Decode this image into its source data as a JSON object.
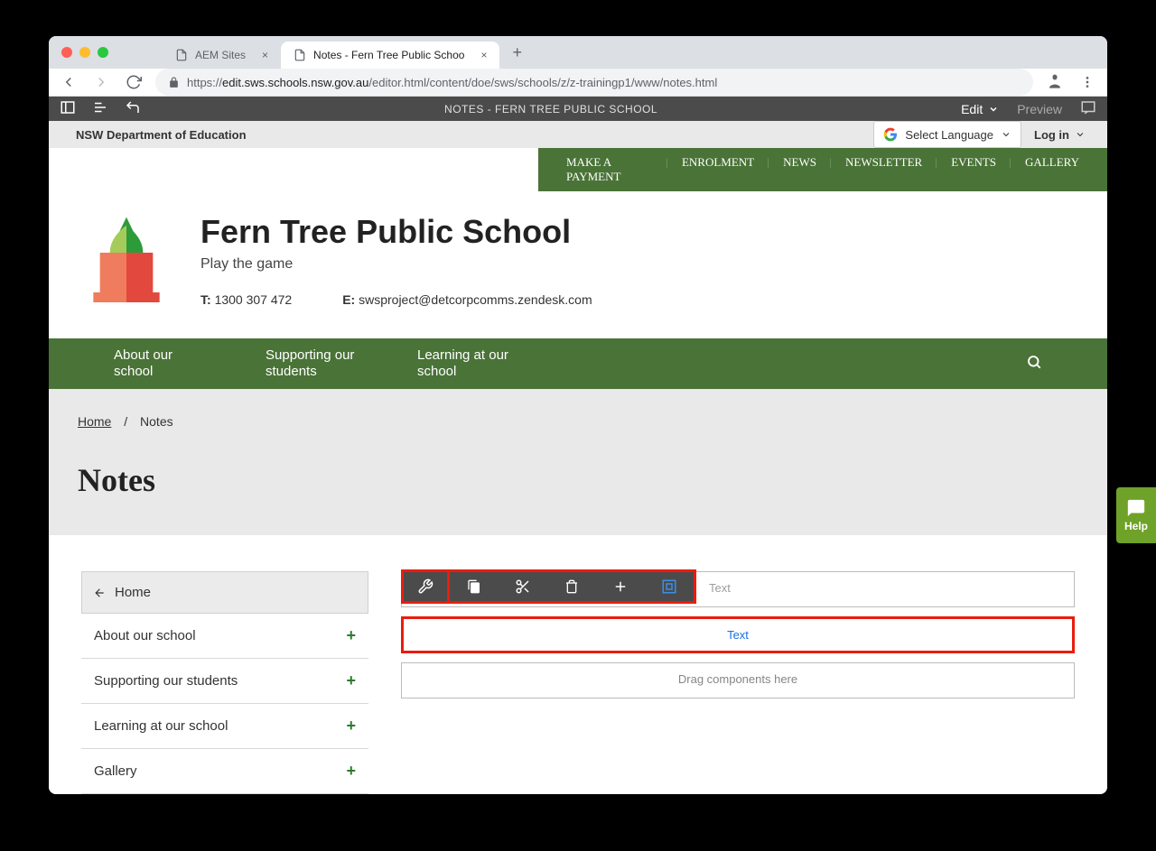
{
  "browser": {
    "tabs": [
      {
        "label": "AEM Sites",
        "active": false
      },
      {
        "label": "Notes - Fern Tree Public Schoo",
        "active": true
      }
    ],
    "url_proto": "https://",
    "url_host": "edit.sws.schools.nsw.gov.au",
    "url_path": "/editor.html/content/doe/sws/schools/z/z-trainingp1/www/notes.html"
  },
  "aem": {
    "title": "NOTES - FERN TREE PUBLIC SCHOOL",
    "edit": "Edit",
    "preview": "Preview"
  },
  "dept": {
    "name": "NSW Department of Education",
    "lang": "Select Language",
    "login": "Log in"
  },
  "util_nav": [
    "MAKE A PAYMENT",
    "ENROLMENT",
    "NEWS",
    "NEWSLETTER",
    "EVENTS",
    "GALLERY"
  ],
  "school": {
    "name": "Fern Tree Public School",
    "tagline": "Play the game",
    "phone_label": "T:",
    "phone": "1300 307 472",
    "email_label": "E:",
    "email": "swsproject@detcorpcomms.zendesk.com"
  },
  "main_nav": [
    "About our school",
    "Supporting our students",
    "Learning at our school"
  ],
  "breadcrumb": {
    "home": "Home",
    "current": "Notes"
  },
  "page_title": "Notes",
  "side_menu": {
    "home": "Home",
    "items": [
      "About our school",
      "Supporting our students",
      "Learning at our school",
      "Gallery"
    ]
  },
  "components": {
    "text1": "Text",
    "text2": "Text",
    "drag": "Drag components here"
  },
  "help": "Help"
}
